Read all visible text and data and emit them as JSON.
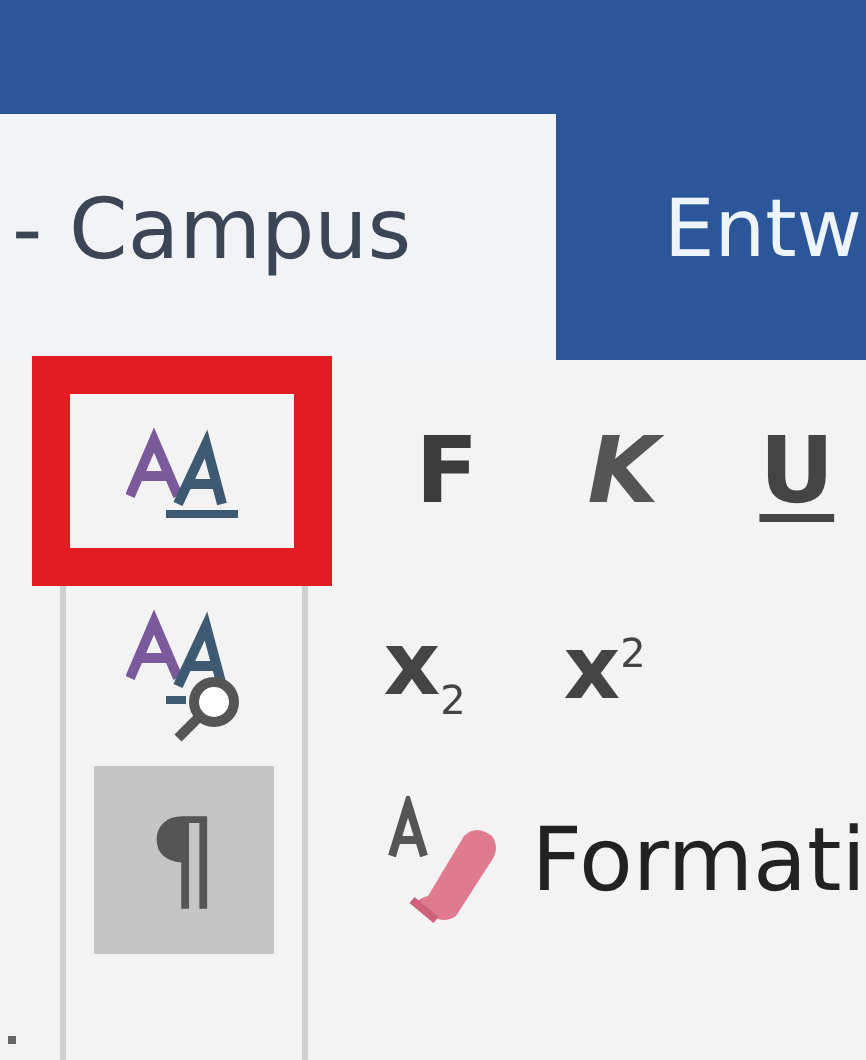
{
  "tabs": [
    {
      "label": "- Campus",
      "selected": true
    },
    {
      "label": "Entw",
      "selected": false
    }
  ],
  "style_tools": [
    {
      "kind": "styles",
      "highlighted": true,
      "on": false
    },
    {
      "kind": "inspector",
      "highlighted": false,
      "on": false
    },
    {
      "kind": "marks",
      "highlighted": false,
      "on": true,
      "label": "¶"
    }
  ],
  "font_buttons": [
    {
      "kind": "bold",
      "label": "F"
    },
    {
      "kind": "italic",
      "label": "K"
    },
    {
      "kind": "underline",
      "label": "U"
    }
  ],
  "script_buttons": [
    {
      "label": "x$_{2}$"
    },
    {
      "label": "x$^{2}$"
    }
  ],
  "clear_formatting": {
    "label": "Formati"
  }
}
